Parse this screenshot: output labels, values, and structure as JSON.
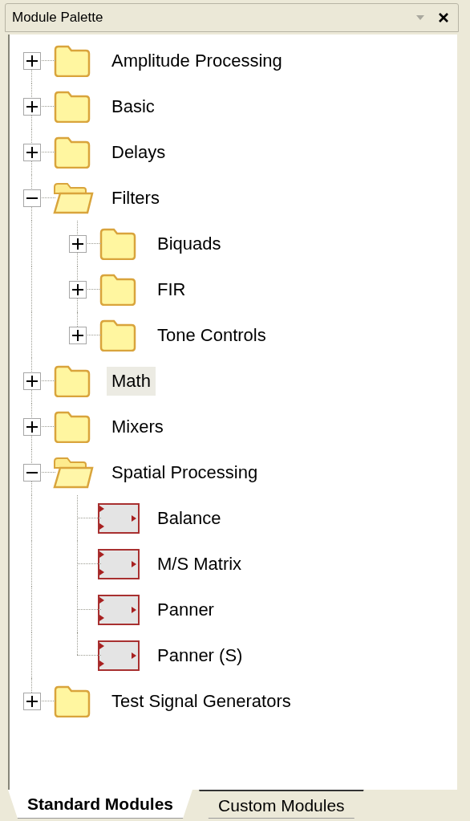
{
  "panel": {
    "title": "Module Palette"
  },
  "tree": [
    {
      "label": "Amplitude Processing",
      "kind": "folder",
      "expanded": false,
      "selected": false
    },
    {
      "label": "Basic",
      "kind": "folder",
      "expanded": false,
      "selected": false
    },
    {
      "label": "Delays",
      "kind": "folder",
      "expanded": false,
      "selected": false
    },
    {
      "label": "Filters",
      "kind": "folder",
      "expanded": true,
      "selected": false,
      "children": [
        {
          "label": "Biquads",
          "kind": "folder",
          "expanded": false,
          "selected": false
        },
        {
          "label": "FIR",
          "kind": "folder",
          "expanded": false,
          "selected": false
        },
        {
          "label": "Tone Controls",
          "kind": "folder",
          "expanded": false,
          "selected": false
        }
      ]
    },
    {
      "label": "Math",
      "kind": "folder",
      "expanded": false,
      "selected": true
    },
    {
      "label": "Mixers",
      "kind": "folder",
      "expanded": false,
      "selected": false
    },
    {
      "label": "Spatial Processing",
      "kind": "folder",
      "expanded": true,
      "selected": false,
      "children": [
        {
          "label": "Balance",
          "kind": "module",
          "selected": false
        },
        {
          "label": "M/S Matrix",
          "kind": "module",
          "selected": false
        },
        {
          "label": "Panner",
          "kind": "module",
          "selected": false
        },
        {
          "label": "Panner (S)",
          "kind": "module",
          "selected": false
        }
      ]
    },
    {
      "label": "Test Signal Generators",
      "kind": "folder",
      "expanded": false,
      "selected": false
    }
  ],
  "tabs": [
    {
      "label": "Standard Modules",
      "selected": true
    },
    {
      "label": "Custom Modules",
      "selected": false
    }
  ]
}
